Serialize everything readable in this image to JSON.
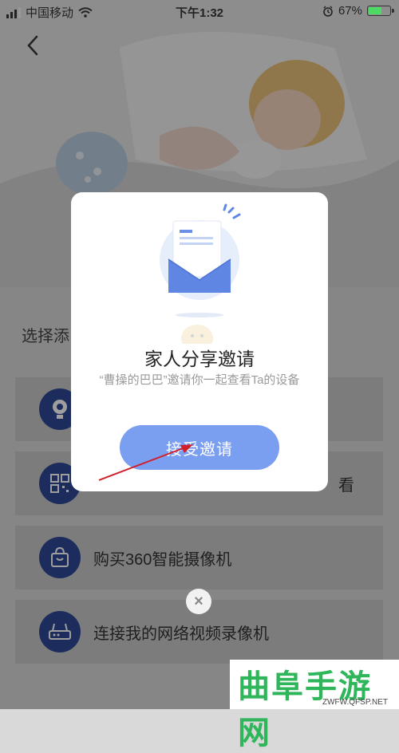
{
  "status_bar": {
    "carrier": "中国移动",
    "time": "下午1:32",
    "battery": "67%",
    "battery_level": 0.67
  },
  "page": {
    "section_title": "选择添",
    "options": [
      {
        "label": "",
        "icon": "camera-icon"
      },
      {
        "label": "",
        "icon": "qr-code-icon"
      },
      {
        "label": "购买360智能摄像机",
        "icon": "shopping-bag-icon"
      },
      {
        "label": "连接我的网络视频录像机",
        "icon": "router-icon"
      }
    ],
    "option_fragment": "看"
  },
  "modal": {
    "title": "家人分享邀请",
    "subtitle": "“曹操的巴巴”邀请你一起查看Ta的设备",
    "accept_label": "接受邀请",
    "close_symbol": "×"
  },
  "watermark": {
    "brand": "曲阜手游网",
    "url": "ZWFW.QFSP.NET"
  },
  "colors": {
    "accent": "#7a9ef0",
    "icon_circle": "#2e4a96",
    "watermark": "#2fb65a",
    "arrow": "#d0202a"
  }
}
